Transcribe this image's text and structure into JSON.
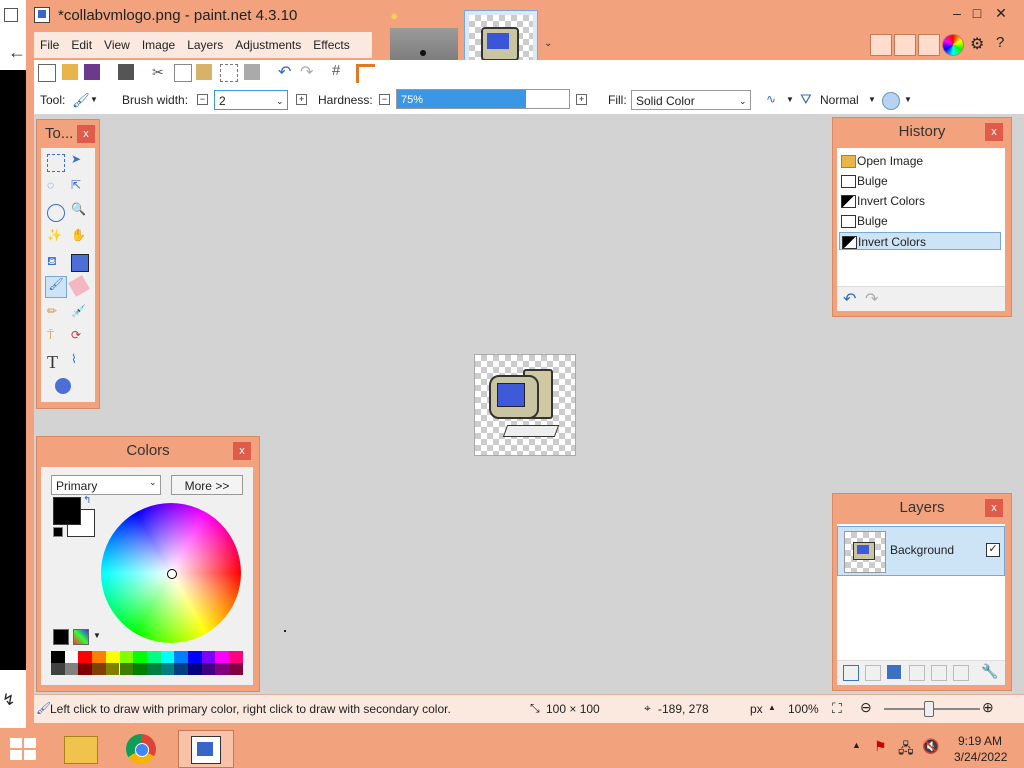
{
  "window": {
    "title": "*collabvmlogo.png - paint.net 4.3.10"
  },
  "caption_buttons": {
    "minimize": "–",
    "maximize": "□",
    "close": "✕"
  },
  "menu": [
    "File",
    "Edit",
    "View",
    "Image",
    "Layers",
    "Adjustments",
    "Effects"
  ],
  "toolbar": {
    "tool_label": "Tool:",
    "brush_width_label": "Brush width:",
    "brush_width_value": "2",
    "hardness_label": "Hardness:",
    "hardness_value": "75%",
    "hardness_percent": 75,
    "fill_label": "Fill:",
    "fill_value": "Solid Color",
    "blend_mode": "Normal"
  },
  "tools_panel": {
    "title": "To...",
    "close": "x"
  },
  "history_panel": {
    "title": "History",
    "close": "x",
    "items": [
      "Open Image",
      "Bulge",
      "Invert Colors",
      "Bulge",
      "Invert Colors"
    ],
    "selected_index": 4
  },
  "colors_panel": {
    "title": "Colors",
    "close": "x",
    "mode": "Primary",
    "more_button": "More >>",
    "primary_color": "#000000",
    "secondary_color": "#ffffff"
  },
  "layers_panel": {
    "title": "Layers",
    "close": "x",
    "layers": [
      {
        "name": "Background",
        "visible": true
      }
    ]
  },
  "status": {
    "hint": "Left click to draw with primary color, right click to draw with secondary color.",
    "image_size": "100 × 100",
    "cursor_pos": "-189, 278",
    "units": "px",
    "zoom": "100%"
  },
  "taskbar": {
    "time": "9:19 AM",
    "date": "3/24/2022"
  },
  "colors": {
    "accent": "#f2a27d",
    "selection": "#cde4f7",
    "hardness_fill": "#3c96e6"
  }
}
